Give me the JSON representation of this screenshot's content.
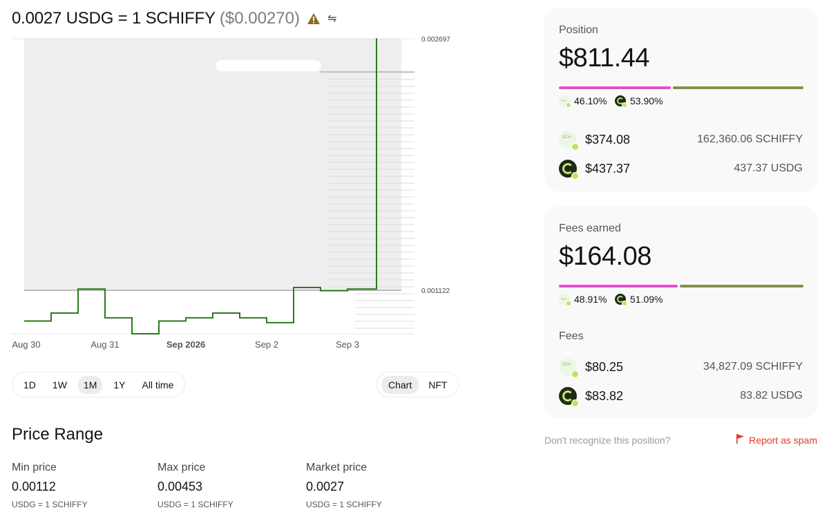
{
  "header": {
    "rate": "0.0027 USDG = 1 SCHIFFY",
    "usd_price": "($0.00270)",
    "warning_icon": "warning-triangle-icon",
    "swap_icon": "swap-arrows-icon"
  },
  "chart_data": {
    "type": "line",
    "x": [
      "Aug 30 00:00",
      "Aug 30 08:00",
      "Aug 30 16:00",
      "Aug 31 00:00",
      "Aug 31 08:00",
      "Aug 31 16:00",
      "Sep 1 00:00",
      "Sep 1 08:00",
      "Sep 1 16:00",
      "Sep 2 00:00",
      "Sep 2 08:00",
      "Sep 2 16:00",
      "Sep 3 00:00",
      "Sep 3 08:00"
    ],
    "values": [
      0.00093,
      0.00098,
      0.00113,
      0.00095,
      0.00085,
      0.00093,
      0.00095,
      0.00098,
      0.00095,
      0.00092,
      0.00114,
      0.00112,
      0.00113,
      0.0027
    ],
    "x_tick_labels": [
      "Aug 30",
      "Aug 31",
      "Sep 2026",
      "Sep 2",
      "Sep 3"
    ],
    "y_labels": [
      "0.002697",
      "0.001122"
    ],
    "current_price": 0.002697,
    "min_price_line": 0.001122,
    "line_color": "#2b7a1a",
    "range_fill": "#eeeeee"
  },
  "timeframes": {
    "items": [
      "1D",
      "1W",
      "1M",
      "1Y",
      "All time"
    ],
    "active": "1M"
  },
  "view_toggle": {
    "items": [
      "Chart",
      "NFT"
    ],
    "active": "Chart"
  },
  "price_range": {
    "title": "Price Range",
    "min": {
      "label": "Min price",
      "value": "0.00112",
      "unit": "USDG = 1 SCHIFFY"
    },
    "max": {
      "label": "Max price",
      "value": "0.00453",
      "unit": "USDG = 1 SCHIFFY"
    },
    "market": {
      "label": "Market price",
      "value": "0.0027",
      "unit": "USDG = 1 SCHIFFY"
    }
  },
  "position": {
    "title": "Position",
    "value": "$811.44",
    "pct_a": "46.10%",
    "pct_b": "53.90%",
    "share_a": 0.461,
    "token_a_usd": "$374.08",
    "token_a_amount": "162,360.06 SCHIFFY",
    "token_b_usd": "$437.37",
    "token_b_amount": "437.37 USDG"
  },
  "fees": {
    "title": "Fees earned",
    "value": "$164.08",
    "pct_a": "48.91%",
    "pct_b": "51.09%",
    "share_a": 0.4891,
    "section_label": "Fees",
    "token_a_usd": "$80.25",
    "token_a_amount": "34,827.09 SCHIFFY",
    "token_b_usd": "$83.82",
    "token_b_amount": "83.82 USDG"
  },
  "colors": {
    "token_a": "#e34fcc",
    "token_b": "#7f9349",
    "spam": "#e03b24"
  },
  "footer": {
    "question": "Don't recognize this position?",
    "spam_label": "Report as spam"
  }
}
